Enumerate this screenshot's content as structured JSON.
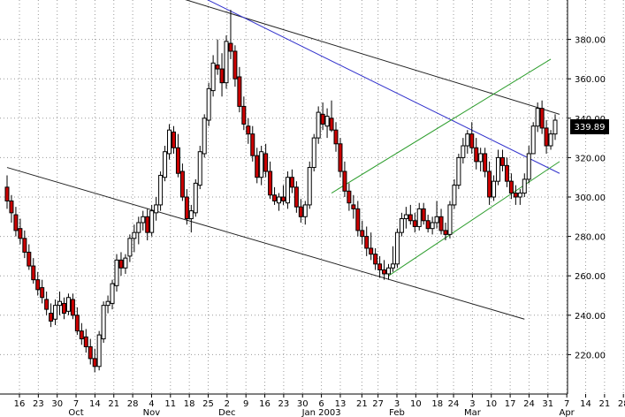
{
  "chart_data": {
    "type": "candlestick",
    "y_axis": {
      "side": "right",
      "min": 200,
      "max": 400,
      "ticks": [
        "220.00",
        "240.00",
        "260.00",
        "280.00",
        "300.00",
        "320.00",
        "340.00",
        "360.00",
        "380.00"
      ]
    },
    "last_price_label": "339.89",
    "day_labels": [
      {
        "label": "16",
        "day": 0
      },
      {
        "label": "23",
        "day": 7
      },
      {
        "label": "30",
        "day": 14
      },
      {
        "label": "7",
        "day": 21
      },
      {
        "label": "14",
        "day": 28
      },
      {
        "label": "21",
        "day": 35
      },
      {
        "label": "28",
        "day": 42
      },
      {
        "label": "4",
        "day": 49
      },
      {
        "label": "11",
        "day": 56
      },
      {
        "label": "18",
        "day": 63
      },
      {
        "label": "25",
        "day": 70
      },
      {
        "label": "2",
        "day": 77
      },
      {
        "label": "9",
        "day": 84
      },
      {
        "label": "16",
        "day": 91
      },
      {
        "label": "23",
        "day": 98
      },
      {
        "label": "30",
        "day": 105
      },
      {
        "label": "6",
        "day": 112
      },
      {
        "label": "13",
        "day": 119
      },
      {
        "label": "21",
        "day": 127
      },
      {
        "label": "27",
        "day": 133
      },
      {
        "label": "3",
        "day": 140
      },
      {
        "label": "10",
        "day": 147
      },
      {
        "label": "18",
        "day": 155
      },
      {
        "label": "24",
        "day": 161
      },
      {
        "label": "3",
        "day": 168
      },
      {
        "label": "10",
        "day": 175
      },
      {
        "label": "17",
        "day": 182
      },
      {
        "label": "24",
        "day": 189
      },
      {
        "label": "31",
        "day": 196
      },
      {
        "label": "7",
        "day": 203
      },
      {
        "label": "14",
        "day": 210
      },
      {
        "label": "21",
        "day": 217
      },
      {
        "label": "28",
        "day": 224
      }
    ],
    "month_labels": [
      {
        "label": "Oct",
        "day": 21
      },
      {
        "label": "Nov",
        "day": 49
      },
      {
        "label": "Dec",
        "day": 77
      },
      {
        "label": "Jan 2003",
        "day": 112
      },
      {
        "label": "Feb",
        "day": 140
      },
      {
        "label": "Mar",
        "day": 168
      },
      {
        "label": "Apr",
        "day": 203
      }
    ],
    "candles": [
      [
        0,
        305,
        311,
        294,
        298
      ],
      [
        1,
        298,
        301,
        287,
        292
      ],
      [
        2,
        291,
        295,
        280,
        283
      ],
      [
        3,
        284,
        289,
        276,
        279
      ],
      [
        4,
        279,
        283,
        269,
        272
      ],
      [
        5,
        272,
        276,
        263,
        265
      ],
      [
        6,
        265,
        269,
        256,
        258
      ],
      [
        7,
        258,
        262,
        250,
        253
      ],
      [
        8,
        254,
        258,
        246,
        249
      ],
      [
        9,
        248,
        252,
        240,
        243
      ],
      [
        10,
        241,
        246,
        234,
        237
      ],
      [
        11,
        238,
        248,
        235,
        245
      ],
      [
        12,
        245,
        252,
        240,
        247
      ],
      [
        13,
        246,
        249,
        238,
        241
      ],
      [
        14,
        242,
        251,
        240,
        249
      ],
      [
        15,
        248,
        251,
        238,
        240
      ],
      [
        16,
        240,
        244,
        230,
        232
      ],
      [
        17,
        232,
        236,
        225,
        228
      ],
      [
        18,
        229,
        233,
        221,
        224
      ],
      [
        19,
        224,
        228,
        215,
        218
      ],
      [
        20,
        218,
        223,
        211,
        214
      ],
      [
        21,
        214,
        232,
        212,
        230
      ],
      [
        22,
        228,
        247,
        226,
        245
      ],
      [
        23,
        245,
        250,
        241,
        247
      ],
      [
        24,
        246,
        258,
        243,
        256
      ],
      [
        25,
        255,
        271,
        252,
        268
      ],
      [
        26,
        268,
        272,
        260,
        264
      ],
      [
        27,
        264,
        271,
        261,
        269
      ],
      [
        28,
        270,
        281,
        267,
        279
      ],
      [
        29,
        279,
        286,
        272,
        282
      ],
      [
        30,
        282,
        290,
        276,
        287
      ],
      [
        31,
        287,
        293,
        283,
        290
      ],
      [
        32,
        290,
        294,
        278,
        282
      ],
      [
        33,
        282,
        296,
        280,
        293
      ],
      [
        34,
        292,
        300,
        288,
        296
      ],
      [
        35,
        296,
        313,
        293,
        311
      ],
      [
        36,
        310,
        326,
        308,
        323
      ],
      [
        37,
        322,
        337,
        319,
        334
      ],
      [
        38,
        333,
        336,
        322,
        325
      ],
      [
        39,
        325,
        332,
        310,
        312
      ],
      [
        40,
        313,
        317,
        298,
        300
      ],
      [
        41,
        300,
        304,
        286,
        289
      ],
      [
        42,
        289,
        296,
        282,
        293
      ],
      [
        43,
        292,
        309,
        290,
        307
      ],
      [
        44,
        306,
        326,
        304,
        323
      ],
      [
        45,
        322,
        342,
        320,
        340
      ],
      [
        46,
        339,
        358,
        336,
        355
      ],
      [
        47,
        354,
        372,
        351,
        368
      ],
      [
        48,
        367,
        380,
        362,
        365
      ],
      [
        49,
        365,
        373,
        351,
        358
      ],
      [
        50,
        358,
        382,
        355,
        379
      ],
      [
        51,
        378,
        395,
        370,
        374
      ],
      [
        52,
        374,
        377,
        356,
        360
      ],
      [
        53,
        361,
        366,
        343,
        346
      ],
      [
        54,
        346,
        351,
        334,
        337
      ],
      [
        55,
        336,
        340,
        327,
        332
      ],
      [
        56,
        332,
        336,
        318,
        321
      ],
      [
        57,
        321,
        325,
        307,
        310
      ],
      [
        58,
        310,
        326,
        306,
        323
      ],
      [
        59,
        322,
        327,
        310,
        313
      ],
      [
        60,
        313,
        318,
        299,
        301
      ],
      [
        61,
        301,
        305,
        296,
        298
      ],
      [
        62,
        297,
        302,
        293,
        300
      ],
      [
        63,
        300,
        306,
        296,
        298
      ],
      [
        64,
        297,
        313,
        294,
        310
      ],
      [
        65,
        310,
        314,
        302,
        305
      ],
      [
        66,
        305,
        308,
        292,
        295
      ],
      [
        67,
        295,
        299,
        287,
        290
      ],
      [
        68,
        290,
        298,
        286,
        296
      ],
      [
        69,
        296,
        318,
        294,
        315
      ],
      [
        70,
        315,
        332,
        313,
        330
      ],
      [
        71,
        330,
        346,
        327,
        343
      ],
      [
        72,
        342,
        348,
        334,
        337
      ],
      [
        73,
        336,
        345,
        330,
        341
      ],
      [
        74,
        340,
        349,
        333,
        334
      ],
      [
        75,
        334,
        338,
        323,
        327
      ],
      [
        76,
        327,
        330,
        310,
        313
      ],
      [
        77,
        313,
        318,
        300,
        303
      ],
      [
        78,
        303,
        307,
        293,
        297
      ],
      [
        79,
        296,
        301,
        289,
        294
      ],
      [
        80,
        294,
        298,
        280,
        283
      ],
      [
        81,
        283,
        288,
        276,
        280
      ],
      [
        82,
        280,
        285,
        270,
        274
      ],
      [
        83,
        274,
        282,
        268,
        271
      ],
      [
        84,
        271,
        274,
        263,
        266
      ],
      [
        85,
        266,
        270,
        259,
        263
      ],
      [
        86,
        263,
        268,
        258,
        261
      ],
      [
        87,
        261,
        266,
        258,
        264
      ],
      [
        88,
        264,
        275,
        262,
        266
      ],
      [
        89,
        266,
        284,
        264,
        282
      ],
      [
        90,
        282,
        292,
        280,
        289
      ],
      [
        91,
        289,
        295,
        284,
        291
      ],
      [
        92,
        291,
        296,
        286,
        288
      ],
      [
        93,
        288,
        292,
        282,
        285
      ],
      [
        94,
        285,
        297,
        283,
        294
      ],
      [
        95,
        294,
        297,
        286,
        288
      ],
      [
        96,
        288,
        291,
        282,
        284
      ],
      [
        97,
        284,
        290,
        281,
        287
      ],
      [
        98,
        287,
        298,
        284,
        290
      ],
      [
        99,
        290,
        294,
        281,
        283
      ],
      [
        100,
        283,
        287,
        278,
        281
      ],
      [
        101,
        281,
        298,
        279,
        296
      ],
      [
        102,
        296,
        309,
        294,
        306
      ],
      [
        103,
        306,
        322,
        304,
        320
      ],
      [
        104,
        320,
        330,
        317,
        326
      ],
      [
        105,
        326,
        334,
        322,
        332
      ],
      [
        106,
        332,
        338,
        322,
        325
      ],
      [
        107,
        325,
        330,
        314,
        318
      ],
      [
        108,
        318,
        325,
        313,
        322
      ],
      [
        109,
        322,
        325,
        310,
        313
      ],
      [
        110,
        313,
        318,
        296,
        300
      ],
      [
        111,
        300,
        311,
        298,
        308
      ],
      [
        112,
        308,
        324,
        306,
        320
      ],
      [
        113,
        320,
        324,
        313,
        316
      ],
      [
        114,
        316,
        320,
        305,
        308
      ],
      [
        115,
        308,
        312,
        299,
        302
      ],
      [
        116,
        302,
        306,
        296,
        300
      ],
      [
        117,
        300,
        304,
        296,
        302
      ],
      [
        118,
        302,
        312,
        300,
        309
      ],
      [
        119,
        309,
        326,
        307,
        322
      ],
      [
        120,
        322,
        338,
        325,
        336
      ],
      [
        121,
        336,
        348,
        333,
        345
      ],
      [
        122,
        345,
        349,
        332,
        335
      ],
      [
        123,
        335,
        339,
        322,
        326
      ],
      [
        124,
        326,
        334,
        324,
        332
      ],
      [
        125,
        332,
        342,
        329,
        339
      ]
    ],
    "trendlines": [
      {
        "color": "#222222",
        "from": [
          38,
          402
        ],
        "to": [
          126,
          342
        ]
      },
      {
        "color": "#3333cc",
        "from": [
          44,
          402
        ],
        "to": [
          126,
          312
        ]
      },
      {
        "color": "#222222",
        "from": [
          0,
          315
        ],
        "to": [
          118,
          238
        ]
      },
      {
        "color": "#2e9e2e",
        "from": [
          74,
          302
        ],
        "to": [
          124,
          370
        ]
      },
      {
        "color": "#2e9e2e",
        "from": [
          87,
          260
        ],
        "to": [
          126,
          318
        ]
      }
    ]
  }
}
